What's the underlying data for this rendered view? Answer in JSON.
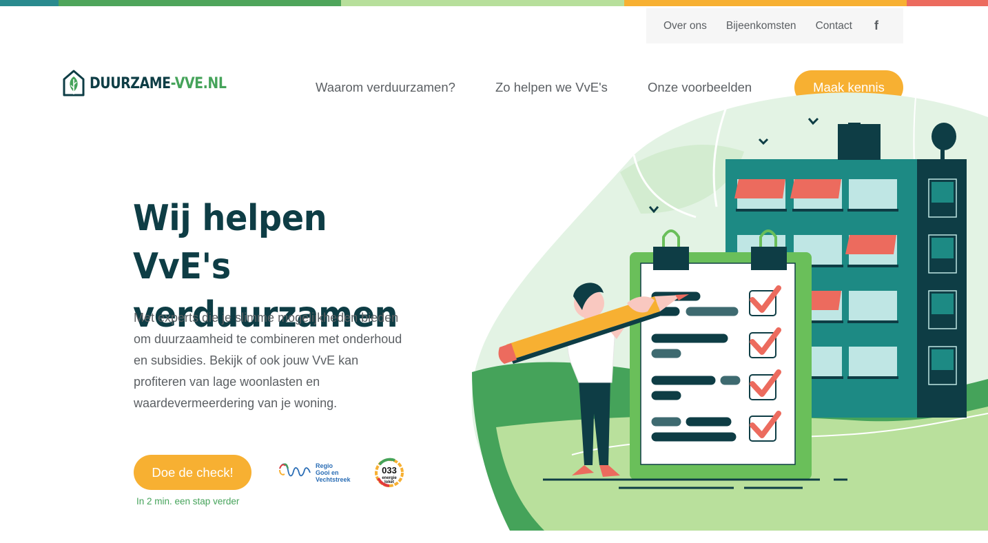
{
  "brand": {
    "logo_part1": "DUURZAME",
    "logo_part2": "-VVE.NL",
    "colors": {
      "dark": "#0e3d45",
      "green": "#45a35a",
      "orange": "#f7b032",
      "coral": "#ec6b5e",
      "teal": "#1d8a84"
    }
  },
  "utility_nav": {
    "items": [
      "Over ons",
      "Bijeenkomsten",
      "Contact"
    ],
    "social_icon": "facebook-icon"
  },
  "main_nav": {
    "items": [
      "Waarom verduurzamen?",
      "Zo helpen we VvE's",
      "Onze voorbeelden"
    ],
    "cta": "Maak kennis"
  },
  "hero": {
    "title": "Wij helpen VvE's verduurzamen",
    "text": "Met experts die je slimme mogelijkheden bieden om duurzaamheid te combineren met onderhoud en subsidies. Bekijk of ook jouw VvE kan profiteren van lage woonlasten en waardevermeerdering van je woning.",
    "cta": "Doe de check!",
    "cta_sub": "In 2 min. een stap verder"
  },
  "partners": [
    {
      "name": "Regio Gooi en Vechtstreek",
      "line1": "Regio",
      "line2": "Gooi en",
      "line3": "Vechtstreek"
    },
    {
      "name": "033 energieloket",
      "line1": "033",
      "line2": "energie",
      "line3": "loket"
    }
  ]
}
